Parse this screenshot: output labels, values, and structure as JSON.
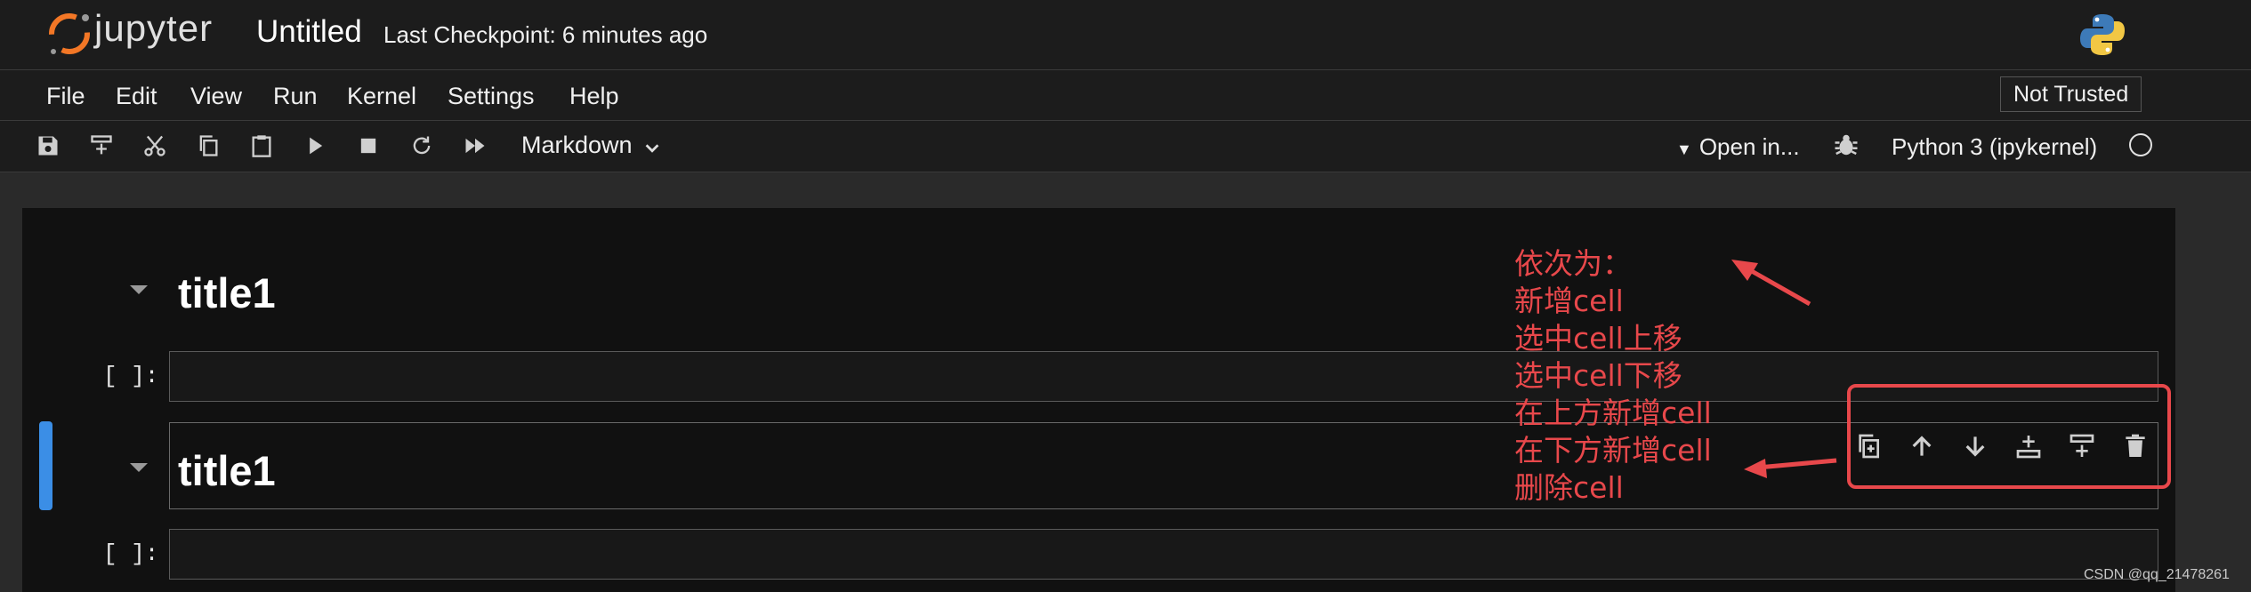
{
  "header": {
    "logo_text": "jupyter",
    "notebook_title": "Untitled",
    "checkpoint": "Last Checkpoint: 6 minutes ago",
    "trust_badge": "Not Trusted"
  },
  "menu": [
    "File",
    "Edit",
    "View",
    "Run",
    "Kernel",
    "Settings",
    "Help"
  ],
  "toolbar": {
    "buttons": [
      "save-icon",
      "insert-cell-below-icon",
      "cut-icon",
      "copy-icon",
      "paste-icon",
      "run-icon",
      "stop-icon",
      "restart-icon",
      "fast-forward-icon"
    ],
    "cell_type": "Markdown",
    "open_in": "Open in...",
    "kernel": "Python 3 (ipykernel)"
  },
  "notebook": {
    "cells": [
      {
        "type": "markdown",
        "text": "title1"
      },
      {
        "type": "code",
        "prompt": "[ ]:"
      },
      {
        "type": "markdown",
        "text": "title1",
        "active": true
      },
      {
        "type": "code",
        "prompt": "[ ]:"
      }
    ]
  },
  "cell_toolbar": [
    "duplicate-cell-icon",
    "move-up-icon",
    "move-down-icon",
    "insert-above-icon",
    "insert-below-icon",
    "delete-icon"
  ],
  "annotation": {
    "lines": [
      "依次为：",
      "新增cell",
      "选中cell上移",
      "选中cell下移",
      "在上方新增cell",
      "在下方新增cell",
      "删除cell"
    ],
    "color": "#e8484b"
  },
  "watermark": "CSDN @qq_21478261",
  "colors": {
    "accent_blue": "#3b8ee6",
    "annotation_red": "#e8484b",
    "jupyter_orange": "#f37726"
  }
}
